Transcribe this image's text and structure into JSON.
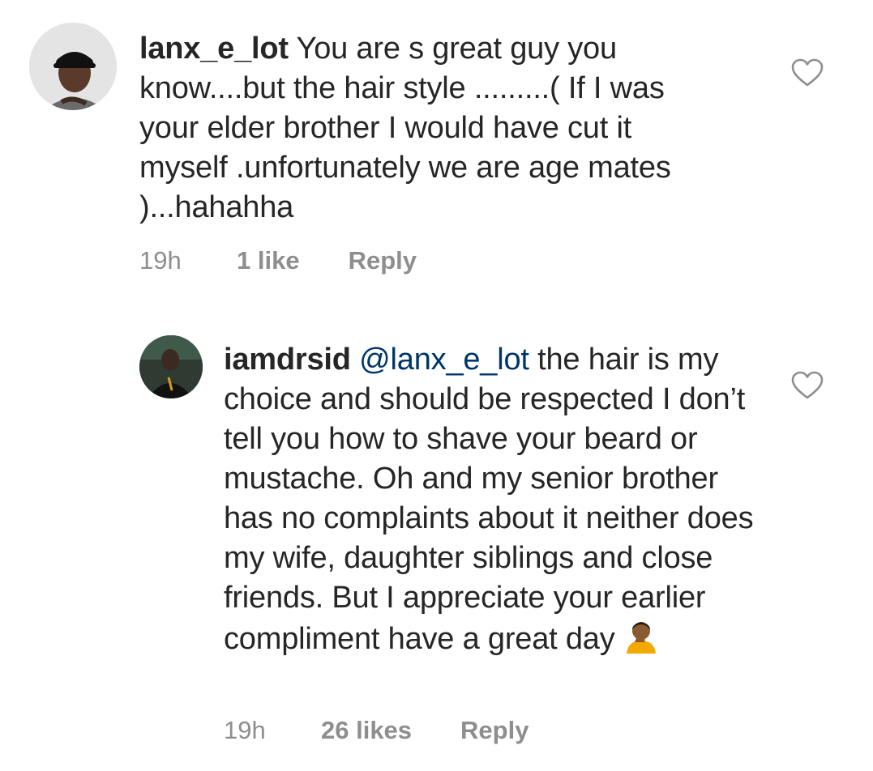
{
  "comments": [
    {
      "username": "lanx_e_lot",
      "text": " You are s great guy you know....but the hair style .........( If I was your elder brother I would have cut it myself .unfortunately we are age mates )...hahahha",
      "time": "19h",
      "likes": "1 like",
      "reply_label": "Reply",
      "avatar_icon": "user-avatar-cap",
      "like_icon": "heart-outline-icon"
    },
    {
      "username": "iamdrsid",
      "mention": "@lanx_e_lot",
      "text": " the hair is my choice and should be respected I don’t tell you how to shave your beard or mustache. Oh and my senior brother has no complaints about it neither does my wife, daughter siblings and close friends. But I appreciate your earlier compliment have a great day ",
      "emoji": "person-facepalming",
      "time": "19h",
      "likes": "26 likes",
      "reply_label": "Reply",
      "avatar_icon": "user-avatar-dark",
      "like_icon": "heart-outline-icon"
    }
  ],
  "colors": {
    "text": "#262626",
    "meta": "#8e8e8e",
    "mention": "#003569",
    "background": "#ffffff"
  }
}
